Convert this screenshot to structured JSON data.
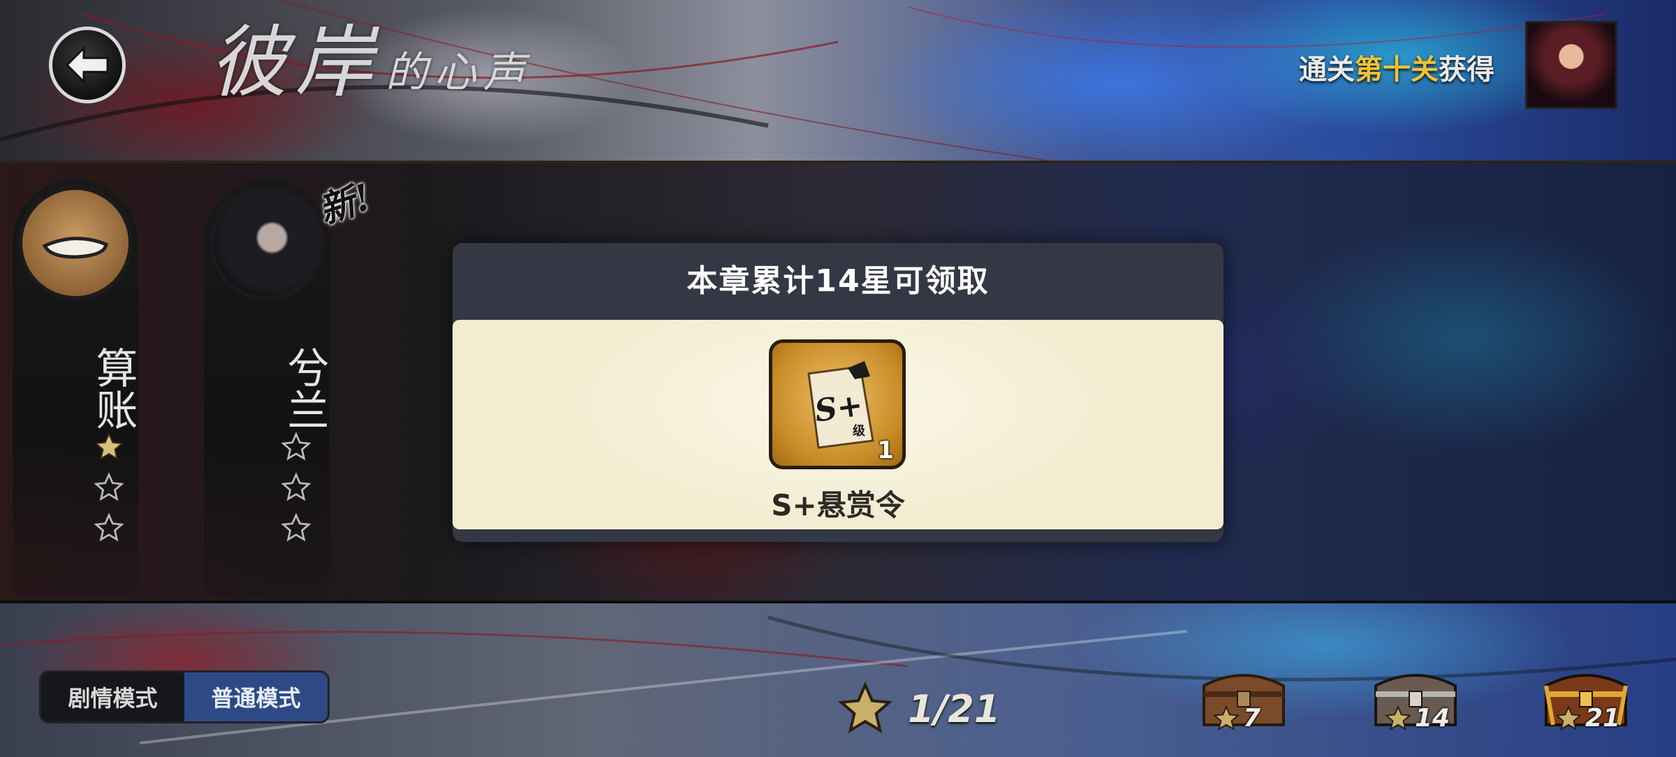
{
  "header": {
    "chapter_title_big": "彼岸",
    "chapter_title_small": "的心声",
    "reward_hint_prefix": "通关",
    "reward_hint_highlight": "第十关",
    "reward_hint_suffix": "获得"
  },
  "levels": [
    {
      "name": "算账",
      "stars_earned": 1,
      "stars_total": 3,
      "is_new": false
    },
    {
      "name": "兮兰",
      "stars_earned": 0,
      "stars_total": 3,
      "is_new": true
    }
  ],
  "new_badge": "新!",
  "dialog": {
    "title": "本章累计14星可领取",
    "item_name": "S+悬赏令",
    "item_count": "1",
    "item_icon_text": "S+",
    "item_icon_sub": "级"
  },
  "mode_toggle": {
    "story_label": "剧情模式",
    "normal_label": "普通模式",
    "active": "normal"
  },
  "star_progress": {
    "text": "1/21",
    "earned": 1,
    "total": 21
  },
  "chests": [
    {
      "required": "7",
      "style": "brown"
    },
    {
      "required": "14",
      "style": "silver"
    },
    {
      "required": "21",
      "style": "gold"
    }
  ],
  "colors": {
    "highlight": "#f2c232",
    "active_mode": "#2d4a86",
    "dialog_header": "#333844",
    "dialog_body": "#f7f2dc"
  }
}
